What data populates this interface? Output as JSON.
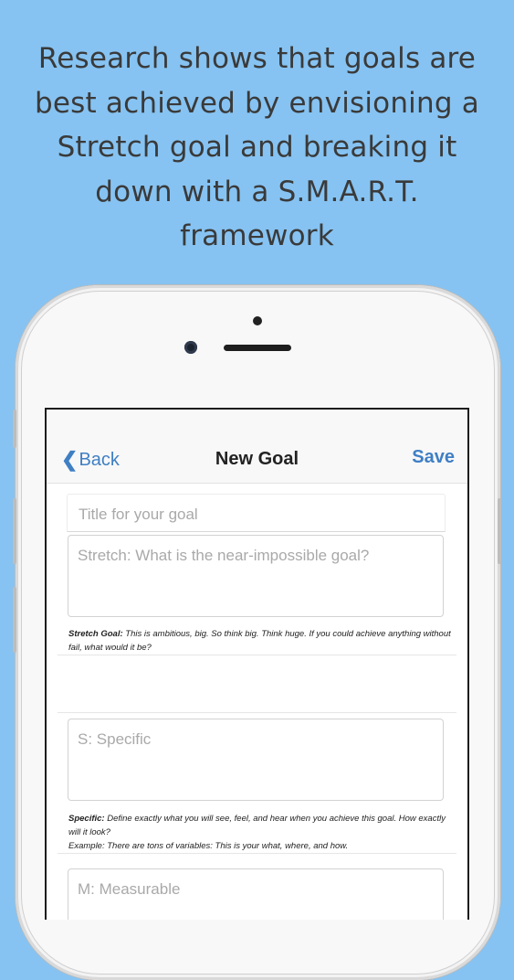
{
  "headline": "Research shows that goals are best achieved by envisioning a Stretch goal and breaking it down with a S.M.A.R.T. framework",
  "navbar": {
    "back_chevron": "❮",
    "back_label": "Back",
    "title": "New Goal",
    "save_label": "Save"
  },
  "form": {
    "title_placeholder": "Title for your goal",
    "stretch_placeholder": "Stretch: What is the near-impossible goal?",
    "stretch_help_label": "Stretch Goal:",
    "stretch_help_text": " This is ambitious, big. So think big. Think huge. If you could achieve anything without fail, what would it be?",
    "specific_placeholder": "S: Specific",
    "specific_help_label": "Specific:",
    "specific_help_text": " Define exactly what you will see, feel, and hear when you achieve this goal. How exactly will it look?",
    "specific_example": "Example: There are tons of variables: This is your what, where, and how.",
    "measurable_placeholder": "M: Measurable"
  },
  "colors": {
    "background": "#86c3f2",
    "accent": "#3f7fc4"
  }
}
